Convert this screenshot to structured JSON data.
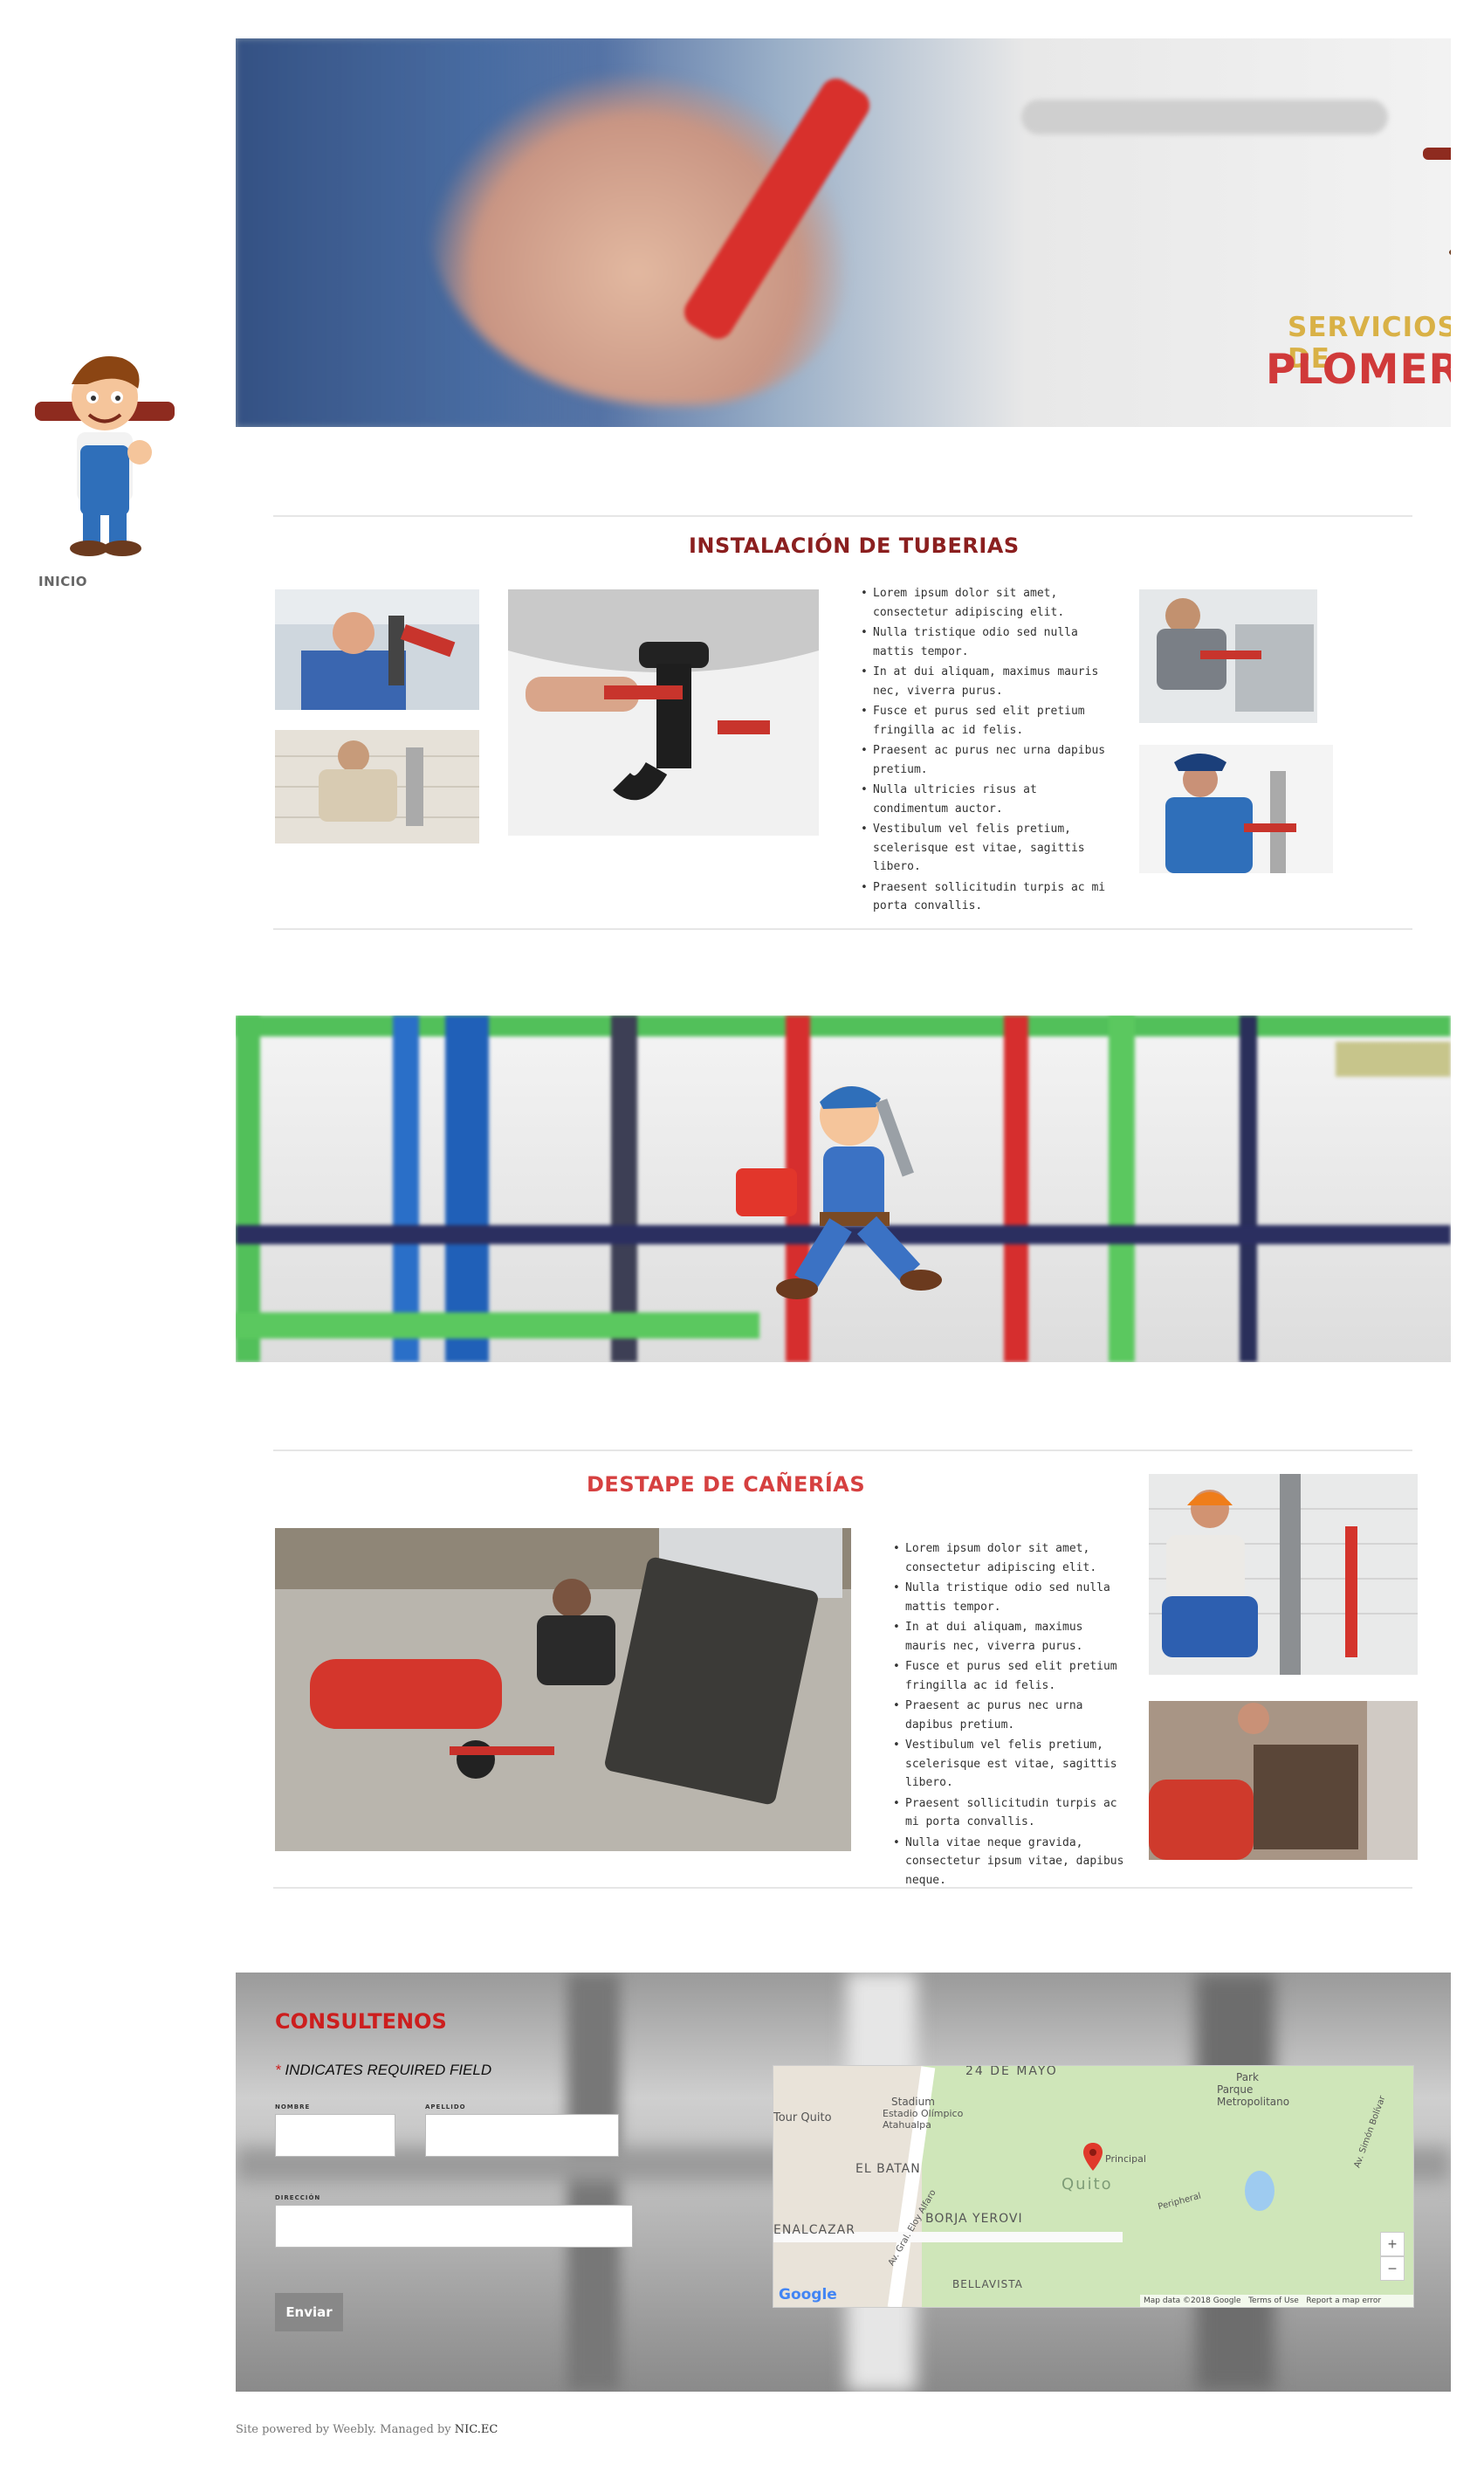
{
  "sidebar": {
    "nav": [
      {
        "label": "INICIO"
      }
    ]
  },
  "hero": {
    "title_line1": "SERVICIOS DE",
    "title_line2": "PLOMERIA"
  },
  "section1": {
    "title": "INSTALACIÓN DE TUBERIAS",
    "bullets": [
      "Lorem ipsum dolor sit amet, consectetur adipiscing elit.",
      "Nulla tristique odio sed nulla mattis tempor.",
      "In at dui aliquam, maximus mauris nec, viverra purus.",
      "Fusce et purus sed elit pretium fringilla ac id felis.",
      "Praesent ac purus nec urna dapibus pretium.",
      "Nulla ultricies risus at condimentum auctor.",
      "Vestibulum vel felis pretium, scelerisque est vitae, sagittis libero.",
      "Praesent sollicitudin turpis ac mi porta convallis."
    ]
  },
  "section2": {
    "title": "DESTAPE DE CAÑERÍAS",
    "bullets": [
      "Lorem ipsum dolor sit amet, consectetur adipiscing elit.",
      "Nulla tristique odio sed nulla mattis tempor.",
      "In at dui aliquam, maximus mauris nec, viverra purus.",
      "Fusce et purus sed elit pretium fringilla ac id felis.",
      "Praesent ac purus nec urna dapibus pretium.",
      "Vestibulum vel felis pretium, scelerisque est vitae, sagittis libero.",
      "Praesent sollicitudin turpis ac mi porta convallis.",
      "Nulla vitae neque gravida, consectetur ipsum vitae, dapibus neque."
    ]
  },
  "contact": {
    "title": "CONSULTENOS",
    "required_star": "*",
    "required_note": "INDICATES REQUIRED FIELD",
    "field_nombre": "NOMBRE",
    "field_apellido": "APELLIDO",
    "field_direccion": "DIRECCIÓN",
    "submit_label": "Enviar"
  },
  "map": {
    "labels": {
      "street_top": "24 DE MAYO",
      "park": "Park",
      "park_name": "Parque Metropolitano",
      "stadium": "Stadium",
      "stadium_name": "Estadio Olímpico Atahualpa",
      "tour": "Tour Quito",
      "batan": "EL BATAN",
      "principal": "Principal",
      "city": "Quito",
      "nalcazar": "ENALCAZAR",
      "borja": "BORJA YEROVI",
      "bellavista": "BELLAVISTA",
      "av_eloy": "Av. Gral. Eloy Alfaro",
      "av_simon": "Av. Simón Bolívar",
      "peripheral": "Peripheral",
      "google": "Google",
      "data": "Map data ©2018 Google",
      "terms": "Terms of Use",
      "report": "Report a map error",
      "zoom_in": "+",
      "zoom_out": "−"
    }
  },
  "footer": {
    "text": "Site powered by Weebly. Managed by",
    "link": "NIC.EC"
  },
  "colors": {
    "section1_title": "#8b1f1f",
    "section2_title": "#d64040",
    "contact_title": "#cc1e1e",
    "hero_title_gold": "#d9b146",
    "hero_title_red": "#d03a3a"
  }
}
